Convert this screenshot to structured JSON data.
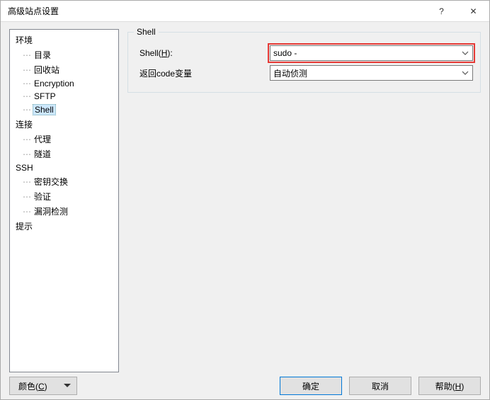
{
  "title": "高级站点设置",
  "titlebar": {
    "help": "?",
    "close": "✕"
  },
  "tree": {
    "groups": [
      {
        "label": "环境",
        "items": [
          "目录",
          "回收站",
          "Encryption",
          "SFTP",
          "Shell"
        ]
      },
      {
        "label": "连接",
        "items": [
          "代理",
          "隧道"
        ]
      },
      {
        "label": "SSH",
        "items": [
          "密钥交换",
          "验证",
          "漏洞检测"
        ]
      },
      {
        "label": "提示",
        "items": []
      }
    ],
    "selected": "Shell"
  },
  "group": {
    "legend": "Shell",
    "rows": [
      {
        "label_pre": "Shell(",
        "label_hot": "H",
        "label_post": "):",
        "value": "sudo -",
        "highlight": true
      },
      {
        "label_pre": "返回code变量",
        "label_hot": "",
        "label_post": "",
        "value": "自动侦测",
        "highlight": false
      }
    ]
  },
  "footer": {
    "color_pre": "颜色(",
    "color_hot": "C",
    "color_post": ")",
    "ok": "确定",
    "cancel": "取消",
    "help_pre": "帮助(",
    "help_hot": "H",
    "help_post": ")"
  }
}
